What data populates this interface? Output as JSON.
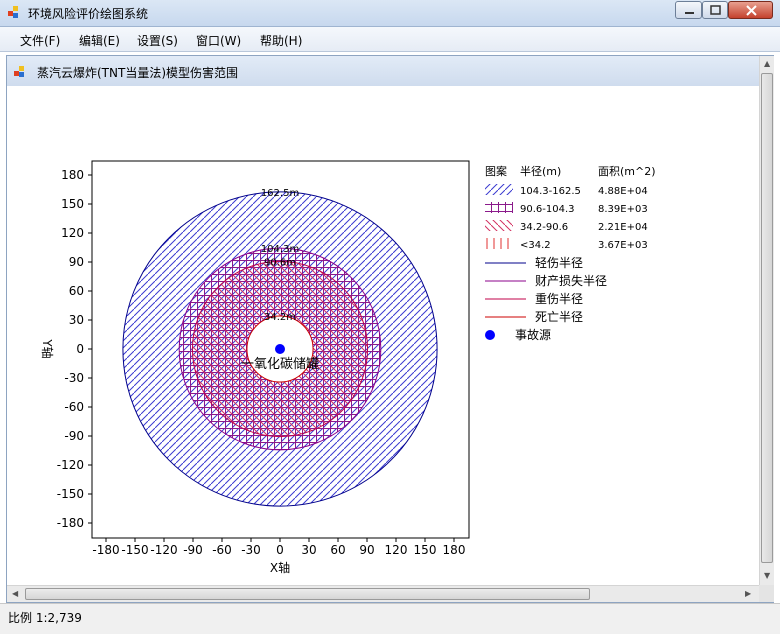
{
  "window": {
    "title": "环境风险评价绘图系统",
    "menu": [
      "文件(F)",
      "编辑(E)",
      "设置(S)",
      "窗口(W)",
      "帮助(H)"
    ]
  },
  "child": {
    "title": "蒸汽云爆炸(TNT当量法)模型伤害范围"
  },
  "chart_data": {
    "type": "circle-zones",
    "xlabel": "X轴",
    "ylabel": "Y轴",
    "xlim": [
      -195,
      195
    ],
    "ylim": [
      -195,
      195
    ],
    "x_ticks": [
      "-180",
      "-150",
      "-120",
      "-90",
      "-60",
      "-30",
      "0",
      "30",
      "60",
      "90",
      "120",
      "150",
      "180"
    ],
    "y_ticks": [
      "180",
      "150",
      "120",
      "90",
      "60",
      "30",
      "0",
      "-30",
      "-60",
      "-90",
      "-120",
      "-150",
      "-180"
    ],
    "circles": [
      {
        "radius": 162.5,
        "label": "162.5m",
        "color": "#00008b"
      },
      {
        "radius": 104.3,
        "label": "104.3m",
        "color": "#8b008b"
      },
      {
        "radius": 90.6,
        "label": "90.6m",
        "color": "#c00048"
      },
      {
        "radius": 34.2,
        "label": "34.2m",
        "color": "#cc0000"
      }
    ],
    "source_label": "一氧化碳储罐",
    "legend_header": {
      "pattern": "图案",
      "radius": "半径(m)",
      "area": "面积(m^2)"
    },
    "legend_zones": [
      {
        "range": "104.3-162.5",
        "area": "4.88E+04",
        "pattern": "diag-blue"
      },
      {
        "range": "90.6-104.3",
        "area": "8.39E+03",
        "pattern": "cross-purple"
      },
      {
        "range": "34.2-90.6",
        "area": "2.21E+04",
        "pattern": "back-diag-red"
      },
      {
        "range": "<34.2",
        "area": "3.67E+03",
        "pattern": "vertical-red"
      }
    ],
    "legend_lines": [
      {
        "label": "轻伤半径",
        "color": "#00008b"
      },
      {
        "label": "财产损失半径",
        "color": "#8b008b"
      },
      {
        "label": "重伤半径",
        "color": "#c00048"
      },
      {
        "label": "死亡半径",
        "color": "#cc0000"
      }
    ],
    "legend_source": {
      "label": "事故源",
      "color": "#0000ff"
    }
  },
  "status": {
    "text": "比例 1:2,739"
  }
}
